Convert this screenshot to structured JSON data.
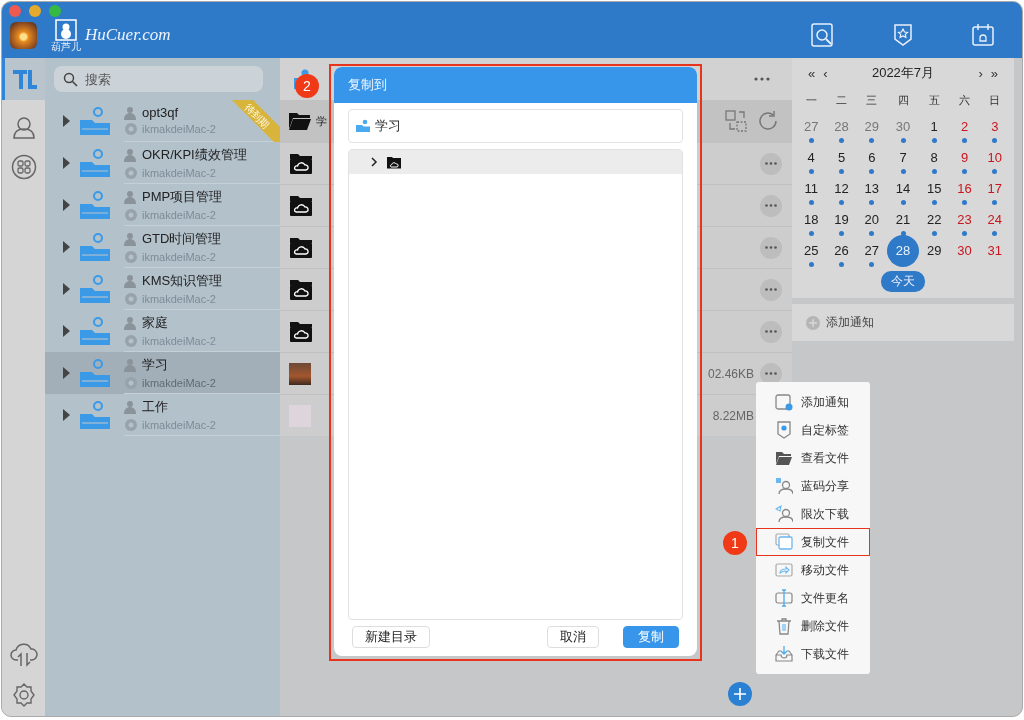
{
  "window": {
    "logo_text": "HuCuer.com",
    "logo_caption": "葫芦儿"
  },
  "search": {
    "placeholder": "搜索"
  },
  "groups": [
    {
      "name": "opt3qf",
      "host": "ikmakdeiMac-2",
      "selected": false,
      "ribbon": "待到期"
    },
    {
      "name": "OKR/KPI绩效管理",
      "host": "ikmakdeiMac-2",
      "selected": false
    },
    {
      "name": "PMP项目管理",
      "host": "ikmakdeiMac-2",
      "selected": false
    },
    {
      "name": "GTD时间管理",
      "host": "ikmakdeiMac-2",
      "selected": false
    },
    {
      "name": "KMS知识管理",
      "host": "ikmakdeiMac-2",
      "selected": false
    },
    {
      "name": "家庭",
      "host": "ikmakdeiMac-2",
      "selected": false
    },
    {
      "name": "学习",
      "host": "ikmakdeiMac-2",
      "selected": true
    },
    {
      "name": "工作",
      "host": "ikmakdeiMac-2",
      "selected": false
    }
  ],
  "folder_view": {
    "path": "学",
    "files": [
      {
        "kind": "cloud-folder"
      },
      {
        "kind": "cloud-folder"
      },
      {
        "kind": "cloud-folder"
      },
      {
        "kind": "cloud-folder"
      },
      {
        "kind": "cloud-folder"
      },
      {
        "kind": "photo",
        "size": "02.46KB"
      },
      {
        "kind": "image",
        "size": "8.22MB"
      }
    ]
  },
  "calendar": {
    "prev_year": "«",
    "prev_month": "‹",
    "month": "2022年7月",
    "next_month": "›",
    "next_year": "»",
    "weekdays": [
      "一",
      "二",
      "三",
      "四",
      "五",
      "六",
      "日"
    ],
    "days": [
      {
        "d": "27",
        "muted": true,
        "weekend": false,
        "dot": true,
        "selected": false
      },
      {
        "d": "28",
        "muted": true,
        "weekend": false,
        "dot": true,
        "selected": false
      },
      {
        "d": "29",
        "muted": true,
        "weekend": false,
        "dot": true,
        "selected": false
      },
      {
        "d": "30",
        "muted": true,
        "weekend": false,
        "dot": true,
        "selected": false
      },
      {
        "d": "1",
        "muted": false,
        "weekend": false,
        "dot": true,
        "selected": false
      },
      {
        "d": "2",
        "muted": false,
        "weekend": true,
        "dot": true,
        "selected": false
      },
      {
        "d": "3",
        "muted": false,
        "weekend": true,
        "dot": true,
        "selected": false
      },
      {
        "d": "4",
        "muted": false,
        "weekend": false,
        "dot": true,
        "selected": false
      },
      {
        "d": "5",
        "muted": false,
        "weekend": false,
        "dot": true,
        "selected": false
      },
      {
        "d": "6",
        "muted": false,
        "weekend": false,
        "dot": true,
        "selected": false
      },
      {
        "d": "7",
        "muted": false,
        "weekend": false,
        "dot": true,
        "selected": false
      },
      {
        "d": "8",
        "muted": false,
        "weekend": false,
        "dot": true,
        "selected": false
      },
      {
        "d": "9",
        "muted": false,
        "weekend": true,
        "dot": true,
        "selected": false
      },
      {
        "d": "10",
        "muted": false,
        "weekend": true,
        "dot": true,
        "selected": false
      },
      {
        "d": "11",
        "muted": false,
        "weekend": false,
        "dot": true,
        "selected": false
      },
      {
        "d": "12",
        "muted": false,
        "weekend": false,
        "dot": true,
        "selected": false
      },
      {
        "d": "13",
        "muted": false,
        "weekend": false,
        "dot": true,
        "selected": false
      },
      {
        "d": "14",
        "muted": false,
        "weekend": false,
        "dot": true,
        "selected": false
      },
      {
        "d": "15",
        "muted": false,
        "weekend": false,
        "dot": true,
        "selected": false
      },
      {
        "d": "16",
        "muted": false,
        "weekend": true,
        "dot": true,
        "selected": false
      },
      {
        "d": "17",
        "muted": false,
        "weekend": true,
        "dot": true,
        "selected": false
      },
      {
        "d": "18",
        "muted": false,
        "weekend": false,
        "dot": true,
        "selected": false
      },
      {
        "d": "19",
        "muted": false,
        "weekend": false,
        "dot": true,
        "selected": false
      },
      {
        "d": "20",
        "muted": false,
        "weekend": false,
        "dot": true,
        "selected": false
      },
      {
        "d": "21",
        "muted": false,
        "weekend": false,
        "dot": true,
        "selected": false
      },
      {
        "d": "22",
        "muted": false,
        "weekend": false,
        "dot": true,
        "selected": false
      },
      {
        "d": "23",
        "muted": false,
        "weekend": true,
        "dot": true,
        "selected": false
      },
      {
        "d": "24",
        "muted": false,
        "weekend": true,
        "dot": true,
        "selected": false
      },
      {
        "d": "25",
        "muted": false,
        "weekend": false,
        "dot": true,
        "selected": false
      },
      {
        "d": "26",
        "muted": false,
        "weekend": false,
        "dot": true,
        "selected": false
      },
      {
        "d": "27",
        "muted": false,
        "weekend": false,
        "dot": true,
        "selected": false
      },
      {
        "d": "28",
        "muted": false,
        "weekend": false,
        "dot": false,
        "selected": true
      },
      {
        "d": "29",
        "muted": false,
        "weekend": false,
        "dot": false,
        "selected": false
      },
      {
        "d": "30",
        "muted": false,
        "weekend": true,
        "dot": false,
        "selected": false
      },
      {
        "d": "31",
        "muted": false,
        "weekend": true,
        "dot": false,
        "selected": false
      }
    ],
    "today_button": "今天"
  },
  "notify_button": "添加通知",
  "dialog": {
    "title": "复制到",
    "target": "学习",
    "buttons": [
      {
        "label": "新建目录",
        "kind": "secondary"
      },
      {
        "label": "取消",
        "kind": "secondary"
      },
      {
        "label": "复制",
        "kind": "primary"
      }
    ]
  },
  "context_menu": [
    {
      "label": "添加通知",
      "kind": "notify",
      "selected": false
    },
    {
      "label": "自定标签",
      "kind": "tag",
      "selected": false
    },
    {
      "label": "查看文件",
      "kind": "view",
      "selected": false
    },
    {
      "label": "蓝码分享",
      "kind": "share",
      "selected": false
    },
    {
      "label": "限次下载",
      "kind": "limit",
      "selected": false
    },
    {
      "label": "复制文件",
      "kind": "copy",
      "selected": true
    },
    {
      "label": "移动文件",
      "kind": "move",
      "selected": false
    },
    {
      "label": "文件更名",
      "kind": "rename",
      "selected": false
    },
    {
      "label": "删除文件",
      "kind": "delete",
      "selected": false
    },
    {
      "label": "下载文件",
      "kind": "download",
      "selected": false
    }
  ],
  "steps": [
    "1",
    "2"
  ]
}
